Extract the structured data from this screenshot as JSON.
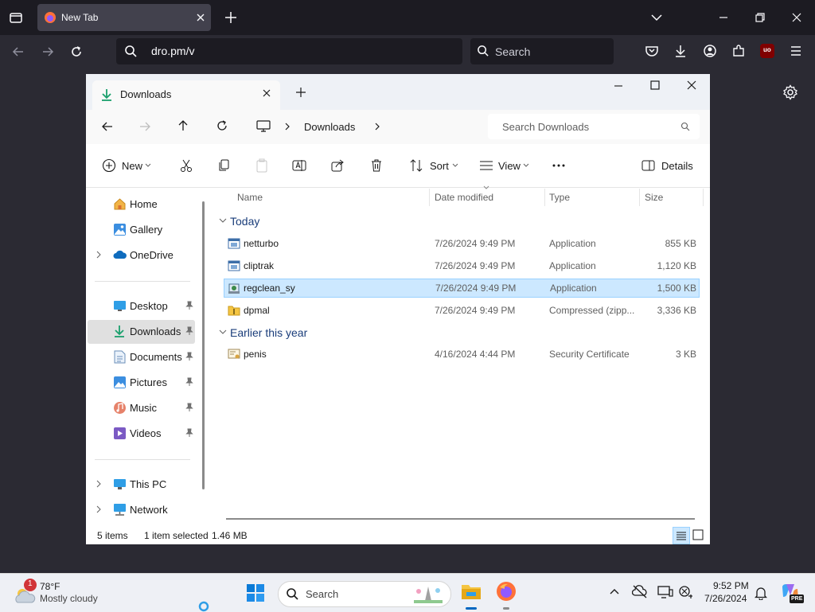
{
  "browser": {
    "tab_title": "New Tab",
    "url": "dro.pm/v",
    "search_placeholder": "Search",
    "ext_badge": "uo"
  },
  "explorer": {
    "tab_title": "Downloads",
    "breadcrumb": "Downloads",
    "search_placeholder": "Search Downloads",
    "toolbar": {
      "new_label": "New",
      "sort_label": "Sort",
      "view_label": "View",
      "details_label": "Details"
    },
    "nav": {
      "home": "Home",
      "gallery": "Gallery",
      "onedrive": "OneDrive",
      "desktop": "Desktop",
      "downloads": "Downloads",
      "documents": "Documents",
      "pictures": "Pictures",
      "music": "Music",
      "videos": "Videos",
      "thispc": "This PC",
      "network": "Network"
    },
    "columns": {
      "name": "Name",
      "date": "Date modified",
      "type": "Type",
      "size": "Size"
    },
    "groups": {
      "today": "Today",
      "earlier": "Earlier this year"
    },
    "files": [
      {
        "name": "netturbo",
        "date": "7/26/2024 9:49 PM",
        "type": "Application",
        "size": "855 KB"
      },
      {
        "name": "cliptrak",
        "date": "7/26/2024 9:49 PM",
        "type": "Application",
        "size": "1,120 KB"
      },
      {
        "name": "regclean_sy",
        "date": "7/26/2024 9:49 PM",
        "type": "Application",
        "size": "1,500 KB"
      },
      {
        "name": "dpmal",
        "date": "7/26/2024 9:49 PM",
        "type": "Compressed (zipp...",
        "size": "3,336 KB"
      },
      {
        "name": "penis",
        "date": "4/16/2024 4:44 PM",
        "type": "Security Certificate",
        "size": "3 KB"
      }
    ],
    "status": {
      "items": "5 items",
      "selected": "1 item selected",
      "size": "1.46 MB"
    }
  },
  "taskbar": {
    "weather_temp": "78°F",
    "weather_desc": "Mostly cloudy",
    "weather_badge": "1",
    "search_label": "Search",
    "time": "9:52 PM",
    "date": "7/26/2024",
    "copilot_badge": "PRE"
  },
  "colors": {
    "accent": "#0067c0",
    "selection": "#cce8ff",
    "browser_bg": "#2b2a33"
  }
}
